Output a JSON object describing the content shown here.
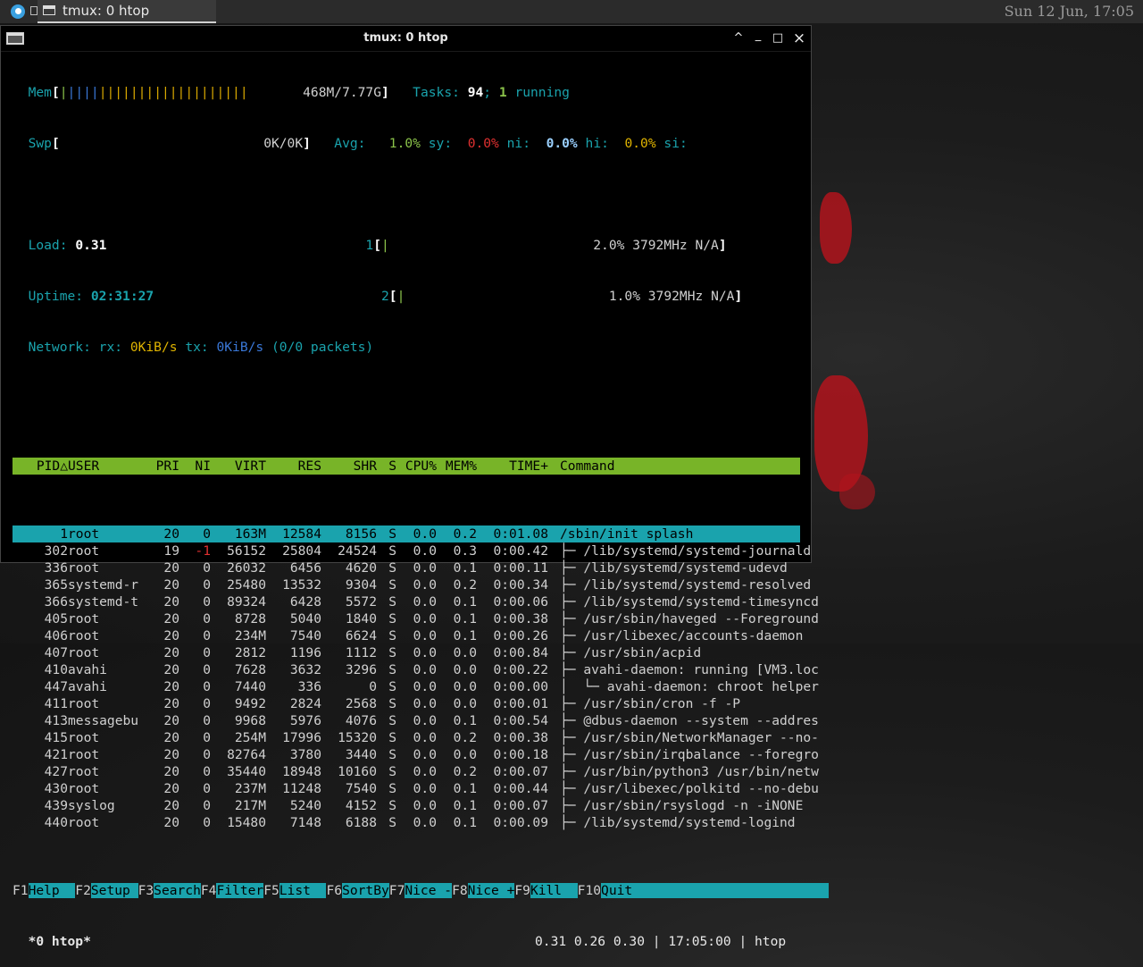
{
  "taskbar": {
    "task_label": "tmux: 0 htop",
    "clock": "Sun 12 Jun, 17:05"
  },
  "window": {
    "title": "tmux: 0 htop",
    "btn_up": "^",
    "btn_min": "_",
    "btn_max": "□",
    "btn_close": "×"
  },
  "htop": {
    "mem_label": "Mem",
    "mem_value": "468M/7.77G",
    "swp_label": "Swp",
    "swp_value": "0K/0K",
    "tasks_label": "Tasks:",
    "tasks_count": "94",
    "tasks_sep": ";",
    "running_count": "1",
    "running_label": "running",
    "avg_label": "Avg:",
    "avg_us": "1.0%",
    "sy_label": "sy:",
    "avg_sy": "0.0%",
    "ni_label": "ni:",
    "avg_ni": "0.0%",
    "hi_label": "hi:",
    "avg_hi": "0.0%",
    "si_label": "si:",
    "load_label": "Load:",
    "load_value": "0.31",
    "uptime_label": "Uptime:",
    "uptime_value": "02:31:27",
    "network_text": "Network: rx: 0KiB/s tx: 0KiB/s (0/0 packets)",
    "network_label": "Network: rx:",
    "net_rx": "0KiB/s",
    "net_tx_label": "tx:",
    "net_tx": "0KiB/s",
    "net_packets": "(0/0 packets)",
    "cpu1_id": "1",
    "cpu1_value": "2.0% 3792MHz N/A",
    "cpu2_id": "2",
    "cpu2_value": "1.0% 3792MHz N/A",
    "columns": {
      "pid": "PID△",
      "user": "USER",
      "pri": "PRI",
      "ni": "NI",
      "virt": "VIRT",
      "res": "RES",
      "shr": "SHR",
      "s": "S",
      "cpu": "CPU%",
      "mem": "MEM%",
      "time": "TIME+",
      "command": "Command"
    },
    "processes": [
      {
        "pid": "1",
        "user": "root",
        "pri": "20",
        "ni": "0",
        "virt": "163M",
        "res": "12584",
        "shr": "8156",
        "s": "S",
        "cpu": "0.0",
        "mem": "0.2",
        "time": "0:01.08",
        "cmd": "/sbin/init splash"
      },
      {
        "pid": "302",
        "user": "root",
        "pri": "19",
        "ni": "-1",
        "virt": "56152",
        "res": "25804",
        "shr": "24524",
        "s": "S",
        "cpu": "0.0",
        "mem": "0.3",
        "time": "0:00.42",
        "cmd": "├─ /lib/systemd/systemd-journald"
      },
      {
        "pid": "336",
        "user": "root",
        "pri": "20",
        "ni": "0",
        "virt": "26032",
        "res": "6456",
        "shr": "4620",
        "s": "S",
        "cpu": "0.0",
        "mem": "0.1",
        "time": "0:00.11",
        "cmd": "├─ /lib/systemd/systemd-udevd"
      },
      {
        "pid": "365",
        "user": "systemd-r",
        "pri": "20",
        "ni": "0",
        "virt": "25480",
        "res": "13532",
        "shr": "9304",
        "s": "S",
        "cpu": "0.0",
        "mem": "0.2",
        "time": "0:00.34",
        "cmd": "├─ /lib/systemd/systemd-resolved"
      },
      {
        "pid": "366",
        "user": "systemd-t",
        "pri": "20",
        "ni": "0",
        "virt": "89324",
        "res": "6428",
        "shr": "5572",
        "s": "S",
        "cpu": "0.0",
        "mem": "0.1",
        "time": "0:00.06",
        "cmd": "├─ /lib/systemd/systemd-timesyncd"
      },
      {
        "pid": "405",
        "user": "root",
        "pri": "20",
        "ni": "0",
        "virt": "8728",
        "res": "5040",
        "shr": "1840",
        "s": "S",
        "cpu": "0.0",
        "mem": "0.1",
        "time": "0:00.38",
        "cmd": "├─ /usr/sbin/haveged --Foreground"
      },
      {
        "pid": "406",
        "user": "root",
        "pri": "20",
        "ni": "0",
        "virt": "234M",
        "res": "7540",
        "shr": "6624",
        "s": "S",
        "cpu": "0.0",
        "mem": "0.1",
        "time": "0:00.26",
        "cmd": "├─ /usr/libexec/accounts-daemon"
      },
      {
        "pid": "407",
        "user": "root",
        "pri": "20",
        "ni": "0",
        "virt": "2812",
        "res": "1196",
        "shr": "1112",
        "s": "S",
        "cpu": "0.0",
        "mem": "0.0",
        "time": "0:00.84",
        "cmd": "├─ /usr/sbin/acpid"
      },
      {
        "pid": "410",
        "user": "avahi",
        "pri": "20",
        "ni": "0",
        "virt": "7628",
        "res": "3632",
        "shr": "3296",
        "s": "S",
        "cpu": "0.0",
        "mem": "0.0",
        "time": "0:00.22",
        "cmd": "├─ avahi-daemon: running [VM3.loc"
      },
      {
        "pid": "447",
        "user": "avahi",
        "pri": "20",
        "ni": "0",
        "virt": "7440",
        "res": "336",
        "shr": "0",
        "s": "S",
        "cpu": "0.0",
        "mem": "0.0",
        "time": "0:00.00",
        "cmd": "│  └─ avahi-daemon: chroot helper"
      },
      {
        "pid": "411",
        "user": "root",
        "pri": "20",
        "ni": "0",
        "virt": "9492",
        "res": "2824",
        "shr": "2568",
        "s": "S",
        "cpu": "0.0",
        "mem": "0.0",
        "time": "0:00.01",
        "cmd": "├─ /usr/sbin/cron -f -P"
      },
      {
        "pid": "413",
        "user": "messagebu",
        "pri": "20",
        "ni": "0",
        "virt": "9968",
        "res": "5976",
        "shr": "4076",
        "s": "S",
        "cpu": "0.0",
        "mem": "0.1",
        "time": "0:00.54",
        "cmd": "├─ @dbus-daemon --system --addres"
      },
      {
        "pid": "415",
        "user": "root",
        "pri": "20",
        "ni": "0",
        "virt": "254M",
        "res": "17996",
        "shr": "15320",
        "s": "S",
        "cpu": "0.0",
        "mem": "0.2",
        "time": "0:00.38",
        "cmd": "├─ /usr/sbin/NetworkManager --no-"
      },
      {
        "pid": "421",
        "user": "root",
        "pri": "20",
        "ni": "0",
        "virt": "82764",
        "res": "3780",
        "shr": "3440",
        "s": "S",
        "cpu": "0.0",
        "mem": "0.0",
        "time": "0:00.18",
        "cmd": "├─ /usr/sbin/irqbalance --foregro"
      },
      {
        "pid": "427",
        "user": "root",
        "pri": "20",
        "ni": "0",
        "virt": "35440",
        "res": "18948",
        "shr": "10160",
        "s": "S",
        "cpu": "0.0",
        "mem": "0.2",
        "time": "0:00.07",
        "cmd": "├─ /usr/bin/python3 /usr/bin/netw"
      },
      {
        "pid": "430",
        "user": "root",
        "pri": "20",
        "ni": "0",
        "virt": "237M",
        "res": "11248",
        "shr": "7540",
        "s": "S",
        "cpu": "0.0",
        "mem": "0.1",
        "time": "0:00.44",
        "cmd": "├─ /usr/libexec/polkitd --no-debu"
      },
      {
        "pid": "439",
        "user": "syslog",
        "pri": "20",
        "ni": "0",
        "virt": "217M",
        "res": "5240",
        "shr": "4152",
        "s": "S",
        "cpu": "0.0",
        "mem": "0.1",
        "time": "0:00.07",
        "cmd": "├─ /usr/sbin/rsyslogd -n -iNONE"
      },
      {
        "pid": "440",
        "user": "root",
        "pri": "20",
        "ni": "0",
        "virt": "15480",
        "res": "7148",
        "shr": "6188",
        "s": "S",
        "cpu": "0.0",
        "mem": "0.1",
        "time": "0:00.09",
        "cmd": "├─ /lib/systemd/systemd-logind"
      }
    ],
    "fkeys": [
      {
        "key": "F1",
        "label": "Help  "
      },
      {
        "key": "F2",
        "label": "Setup "
      },
      {
        "key": "F3",
        "label": "Search"
      },
      {
        "key": "F4",
        "label": "Filter"
      },
      {
        "key": "F5",
        "label": "List  "
      },
      {
        "key": "F6",
        "label": "SortBy"
      },
      {
        "key": "F7",
        "label": "Nice -"
      },
      {
        "key": "F8",
        "label": "Nice +"
      },
      {
        "key": "F9",
        "label": "Kill  "
      },
      {
        "key": "F10",
        "label": "Quit                         "
      }
    ]
  },
  "tmux_status": {
    "left": "*0 htop*",
    "right": "0.31 0.26 0.30 | 17:05:00 | htop"
  }
}
